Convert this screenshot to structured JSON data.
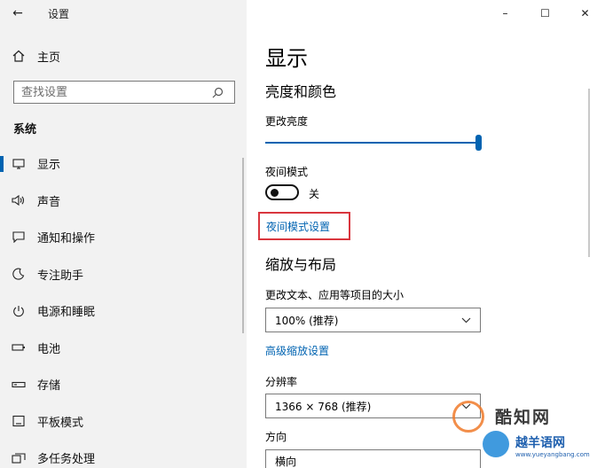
{
  "window": {
    "title": "设置",
    "controls": {
      "minimize": "–",
      "maximize": "☐",
      "close": "✕"
    }
  },
  "sidebar": {
    "back_label": "←",
    "home_label": "主页",
    "search_placeholder": "查找设置",
    "section_label": "系统",
    "items": [
      {
        "label": "显示",
        "icon": "monitor-icon",
        "active": true
      },
      {
        "label": "声音",
        "icon": "speaker-icon",
        "active": false
      },
      {
        "label": "通知和操作",
        "icon": "notification-icon",
        "active": false
      },
      {
        "label": "专注助手",
        "icon": "moon-icon",
        "active": false
      },
      {
        "label": "电源和睡眠",
        "icon": "power-icon",
        "active": false
      },
      {
        "label": "电池",
        "icon": "battery-icon",
        "active": false
      },
      {
        "label": "存储",
        "icon": "storage-icon",
        "active": false
      },
      {
        "label": "平板模式",
        "icon": "tablet-icon",
        "active": false
      },
      {
        "label": "多任务处理",
        "icon": "multitask-icon",
        "active": false
      }
    ]
  },
  "main": {
    "page_title": "显示",
    "brightness": {
      "heading": "亮度和颜色",
      "label": "更改亮度",
      "level_percent": 100
    },
    "night_light": {
      "label": "夜间模式",
      "state": "关",
      "settings_link": "夜间模式设置"
    },
    "scale": {
      "heading": "缩放与布局",
      "size_label": "更改文本、应用等项目的大小",
      "size_value": "100% (推荐)",
      "advanced_link": "高级缩放设置",
      "resolution_label": "分辨率",
      "resolution_value": "1366 × 768 (推荐)",
      "orientation_label": "方向",
      "orientation_value": "横向"
    }
  },
  "watermark": {
    "title": "酷知网",
    "subtitle": "越羊语网",
    "url": "www.yueyangbang.com"
  },
  "colors": {
    "accent": "#0063b1",
    "highlight_box": "#d9363e",
    "sidebar_bg": "#f2f2f2"
  }
}
